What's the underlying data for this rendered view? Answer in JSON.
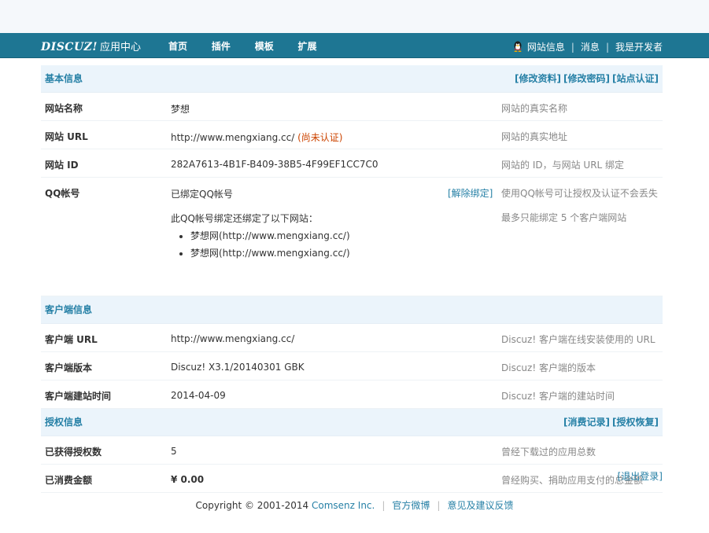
{
  "nav": {
    "logo": "DISCUZ!",
    "subtitle": "应用中心",
    "items": [
      {
        "label": "首页"
      },
      {
        "label": "插件"
      },
      {
        "label": "模板"
      },
      {
        "label": "扩展"
      }
    ],
    "user_links": {
      "site_info": "网站信息",
      "messages": "消息",
      "developer": "我是开发者"
    }
  },
  "basic": {
    "title": "基本信息",
    "links": {
      "edit_profile": "[修改资料]",
      "change_password": "[修改密码]",
      "site_verify": "[站点认证]"
    },
    "rows": {
      "site_name": {
        "label": "网站名称",
        "value": "梦想",
        "desc": "网站的真实名称"
      },
      "site_url": {
        "label": "网站 URL",
        "value": "http://www.mengxiang.cc/",
        "status": "(尚未认证)",
        "desc": "网站的真实地址"
      },
      "site_id": {
        "label": "网站 ID",
        "value": "282A7613-4B1F-B409-38B5-4F99EF1CC7C0",
        "desc": "网站的 ID，与网站 URL 绑定"
      },
      "qq": {
        "label": "QQ帐号",
        "value": "已绑定QQ帐号",
        "unbind": "[解除绑定]",
        "desc": "使用QQ帐号可让授权及认证不会丢失",
        "note": "此QQ帐号绑定还绑定了以下网站：",
        "sites": [
          "梦想网(http://www.mengxiang.cc/)",
          "梦想网(http://www.mengxiang.cc/)"
        ],
        "desc2": "最多只能绑定 5 个客户端网站"
      }
    }
  },
  "client": {
    "title": "客户端信息",
    "rows": {
      "url": {
        "label": "客户端 URL",
        "value": "http://www.mengxiang.cc/",
        "desc": "Discuz! 客户端在线安装使用的 URL"
      },
      "version": {
        "label": "客户端版本",
        "value": "Discuz! X3.1/20140301 GBK",
        "desc": "Discuz! 客户端的版本"
      },
      "created": {
        "label": "客户端建站时间",
        "value": "2014-04-09",
        "desc": "Discuz! 客户端的建站时间"
      }
    }
  },
  "license": {
    "title": "授权信息",
    "links": {
      "records": "[消费记录]",
      "restore": "[授权恢复]"
    },
    "rows": {
      "count": {
        "label": "已获得授权数",
        "value": "5",
        "desc": "曾经下载过的应用总数"
      },
      "spent": {
        "label": "已消费金额",
        "value": "¥ 0.00",
        "desc": "曾经购买、捐助应用支付的总金额"
      }
    }
  },
  "logout": "[退出登录]",
  "footer": {
    "copyright": "Copyright © 2001-2014",
    "company": "Comsenz Inc.",
    "weibo": "官方微博",
    "feedback": "意见及建议反馈"
  },
  "colors": {
    "navbar": "#1e7693",
    "accent": "#2680a6",
    "section_bg": "#ebf4fb",
    "warning": "#cc4400",
    "money": "#f26c00"
  }
}
